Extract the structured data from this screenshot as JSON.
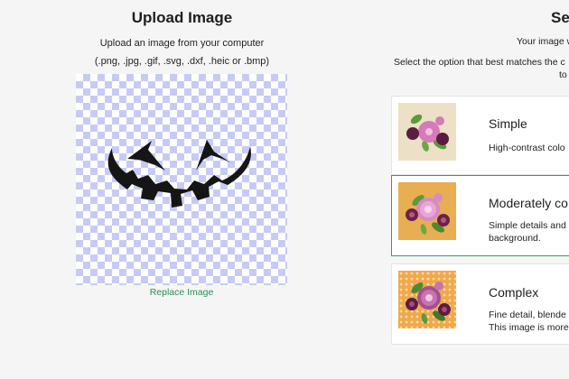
{
  "upload": {
    "title": "Upload Image",
    "subtitle": "Upload an image from your computer",
    "formats": "(.png, .jpg, .gif, .svg, .dxf, .heic or .bmp)",
    "replace_label": "Replace Image"
  },
  "select": {
    "title": "Sel",
    "subtitle_1": "Your image w",
    "subtitle_2": "Select the option that best matches the c",
    "subtitle_3": "to"
  },
  "options": [
    {
      "name": "Simple",
      "desc_1": "High-contrast colo",
      "desc_2": "",
      "selected": false,
      "thumb_bg": "#ece0c6"
    },
    {
      "name": "Moderately co",
      "desc_1": "Simple details and",
      "desc_2": "background.",
      "selected": true,
      "thumb_bg": "#e8ae52"
    },
    {
      "name": "Complex",
      "desc_1": "Fine detail, blende",
      "desc_2": "This image is more",
      "selected": false,
      "thumb_bg": "#f0a84a"
    }
  ],
  "colors": {
    "accent": "#3b9a5a",
    "link": "#2e8b57",
    "checker": "#c7cbf3",
    "flower_pink": "#d77ab8",
    "flower_plum": "#5b1d3f",
    "leaf": "#5c9a3b"
  }
}
